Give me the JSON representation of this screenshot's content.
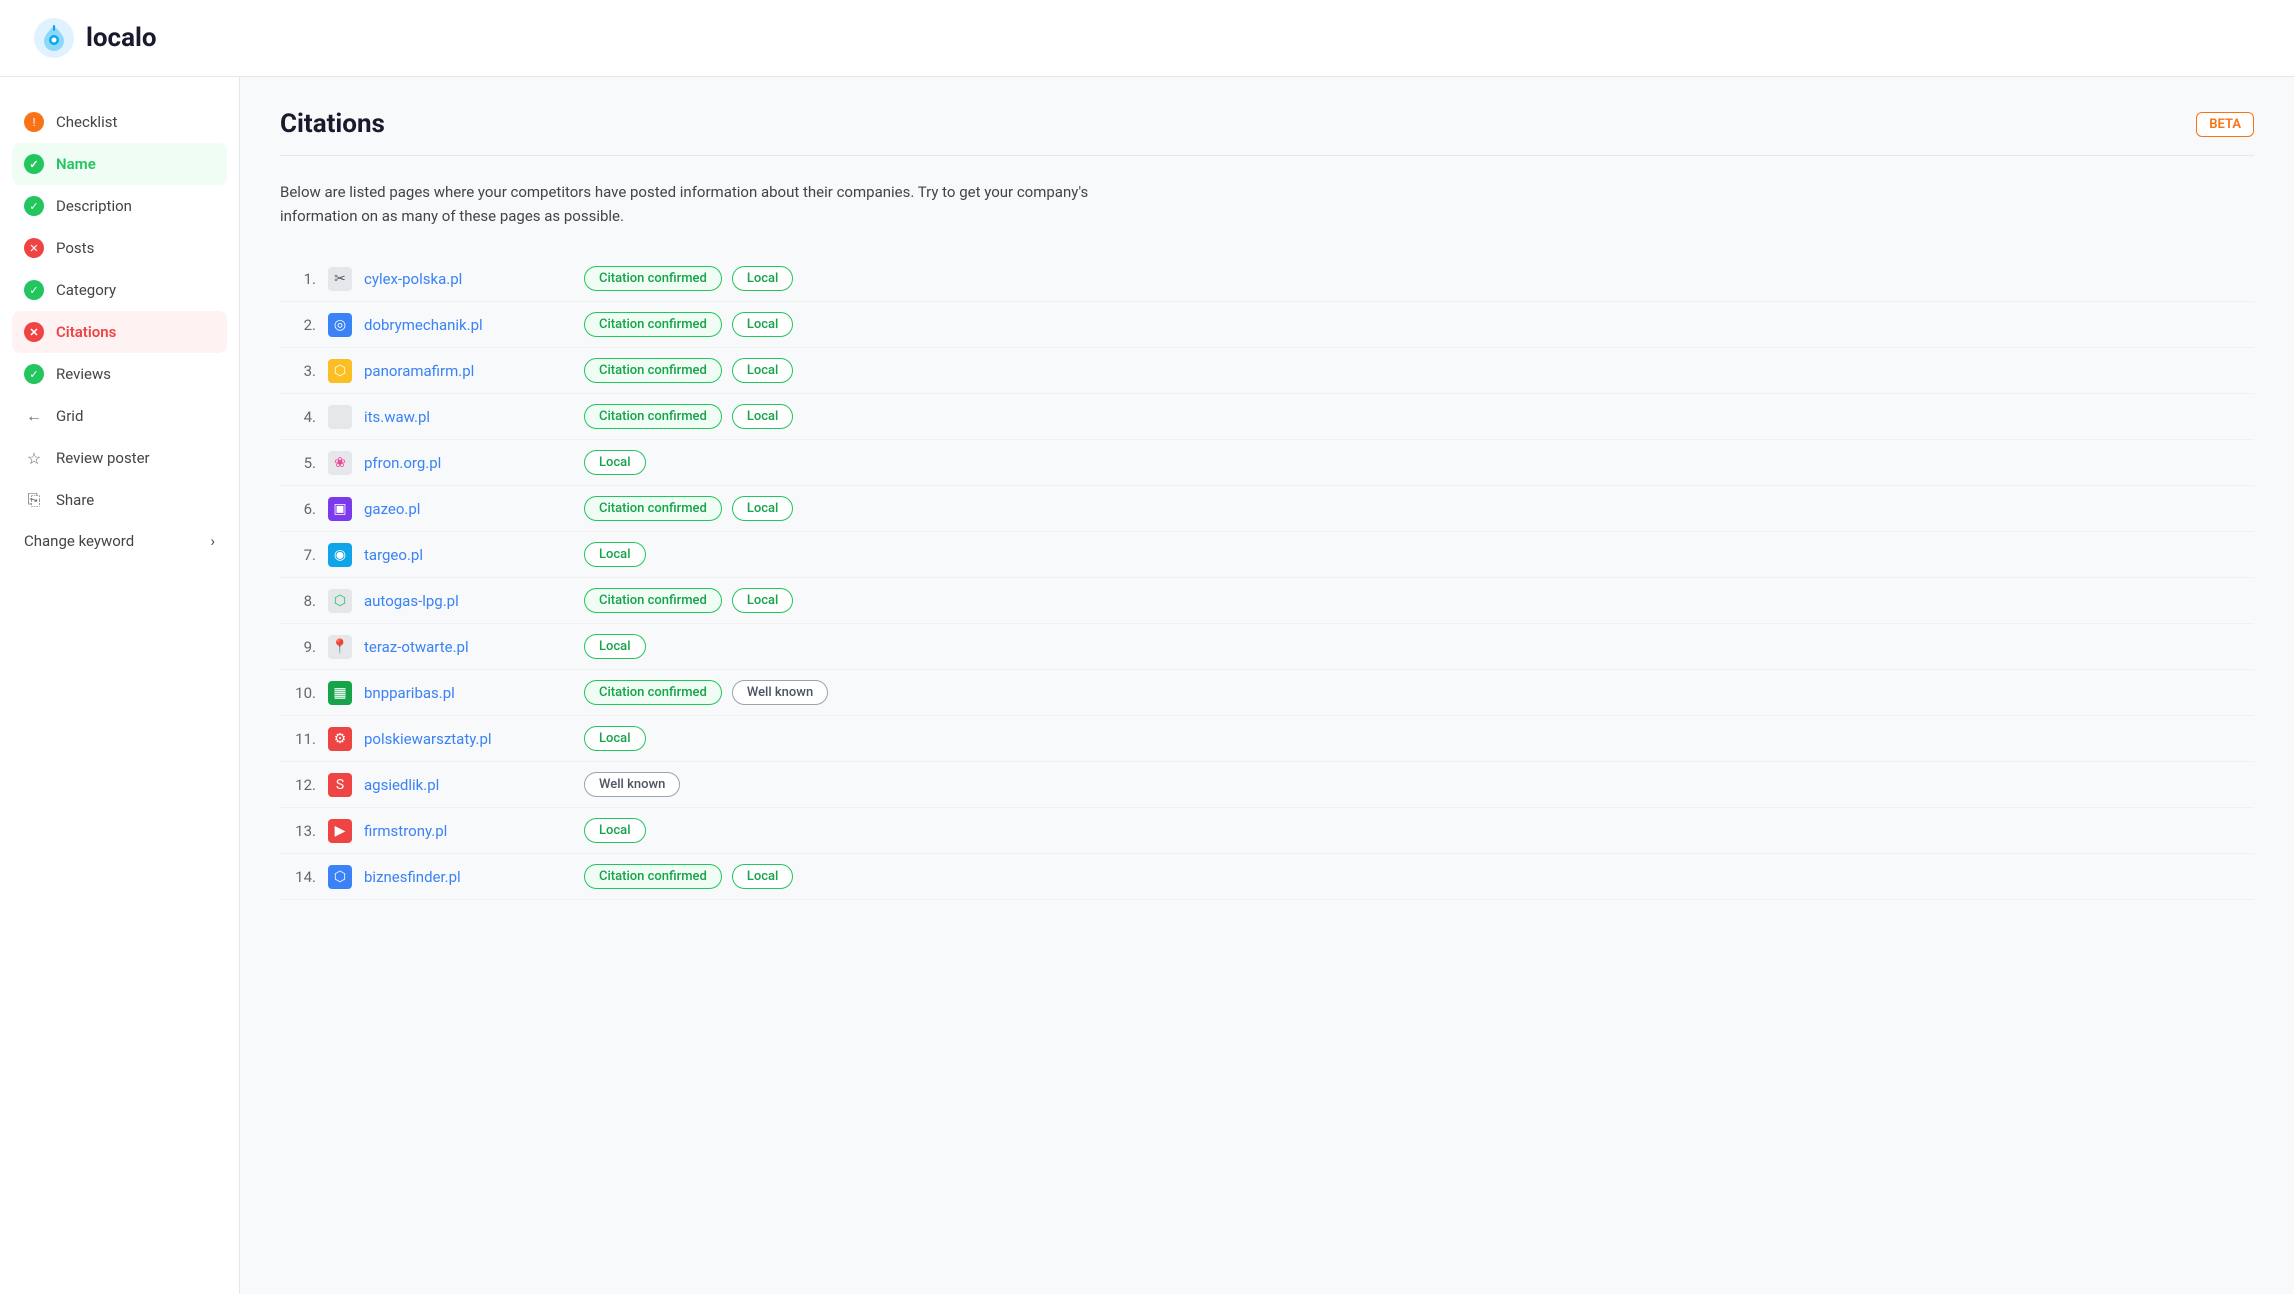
{
  "header": {
    "logo_text": "localo"
  },
  "sidebar": {
    "items": [
      {
        "id": "checklist",
        "label": "Checklist",
        "status": "orange",
        "icon": null
      },
      {
        "id": "name",
        "label": "Name",
        "status": "green",
        "icon": null,
        "active_green": true
      },
      {
        "id": "description",
        "label": "Description",
        "status": "green",
        "icon": null
      },
      {
        "id": "posts",
        "label": "Posts",
        "status": "red",
        "icon": null
      },
      {
        "id": "category",
        "label": "Category",
        "status": "green",
        "icon": null
      },
      {
        "id": "citations",
        "label": "Citations",
        "status": "red",
        "icon": null,
        "active": true
      },
      {
        "id": "reviews",
        "label": "Reviews",
        "status": "green",
        "icon": null
      },
      {
        "id": "grid",
        "label": "Grid",
        "icon": "back_arrow"
      },
      {
        "id": "review-poster",
        "label": "Review poster",
        "icon": "star"
      },
      {
        "id": "share",
        "label": "Share",
        "icon": "share"
      }
    ],
    "change_keyword_label": "Change keyword",
    "change_keyword_arrow": "›"
  },
  "main": {
    "title": "Citations",
    "beta_label": "BETA",
    "description": "Below are listed pages where your competitors have posted information about their companies. Try to get your company's information on as many of these pages as possible.",
    "citations": [
      {
        "number": "1.",
        "emoji": "✂️",
        "site": "cylex-polska.pl",
        "confirmed": true,
        "tag": "Local"
      },
      {
        "number": "2.",
        "emoji": "🔵",
        "site": "dobrymechanik.pl",
        "confirmed": true,
        "tag": "Local"
      },
      {
        "number": "3.",
        "emoji": "🟡",
        "site": "panoramafirm.pl",
        "confirmed": true,
        "tag": "Local"
      },
      {
        "number": "4.",
        "emoji": "",
        "site": "its.waw.pl",
        "confirmed": true,
        "tag": "Local"
      },
      {
        "number": "5.",
        "emoji": "🌸",
        "site": "pfron.org.pl",
        "confirmed": false,
        "tag": "Local"
      },
      {
        "number": "6.",
        "emoji": "🟣",
        "site": "gazeo.pl",
        "confirmed": true,
        "tag": "Local"
      },
      {
        "number": "7.",
        "emoji": "🎯",
        "site": "targeo.pl",
        "confirmed": false,
        "tag": "Local"
      },
      {
        "number": "8.",
        "emoji": "",
        "site": "autogas-lpg.pl",
        "confirmed": true,
        "tag": "Local"
      },
      {
        "number": "9.",
        "emoji": "📍",
        "site": "teraz-otwarte.pl",
        "confirmed": false,
        "tag": "Local"
      },
      {
        "number": "10.",
        "emoji": "🟩",
        "site": "bnpparibas.pl",
        "confirmed": true,
        "tag": "Well known"
      },
      {
        "number": "11.",
        "emoji": "🔴",
        "site": "polskiewarsztaty.pl",
        "confirmed": false,
        "tag": "Local"
      },
      {
        "number": "12.",
        "emoji": "🔴",
        "site": "agsiedlik.pl",
        "confirmed": false,
        "tag": "Well known"
      },
      {
        "number": "13.",
        "emoji": "🔴",
        "site": "firmstrony.pl",
        "confirmed": false,
        "tag": "Local"
      },
      {
        "number": "14.",
        "emoji": "🟦",
        "site": "biznesfinder.pl",
        "confirmed": true,
        "tag": "Local"
      }
    ],
    "confirmed_label": "Citation confirmed",
    "local_label": "Local",
    "wellknown_label": "Well known"
  }
}
